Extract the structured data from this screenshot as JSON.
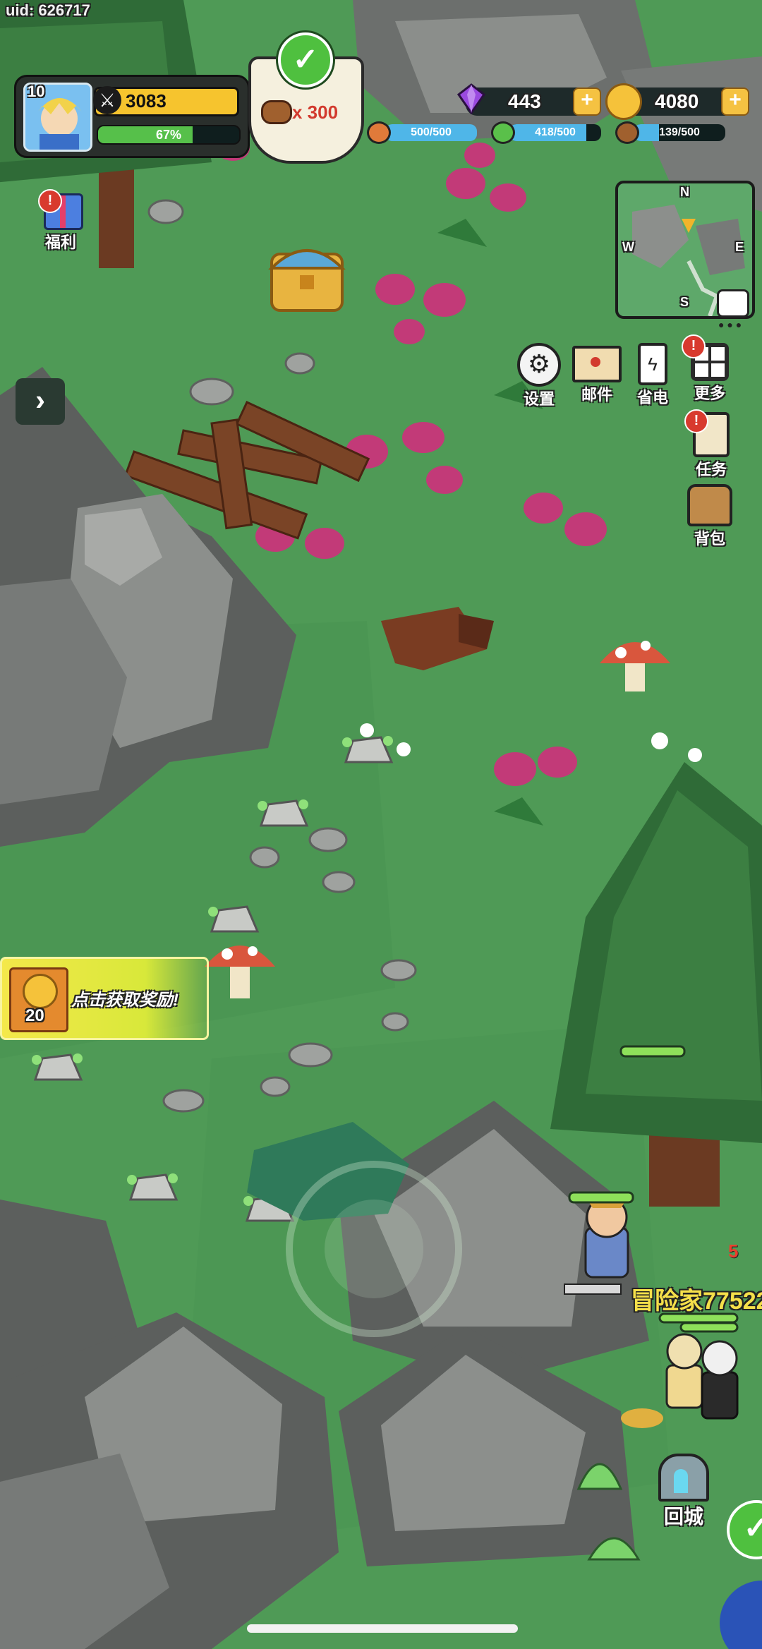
{
  "uid": "uid: 626717",
  "player": {
    "level": "10",
    "power": "3083",
    "exp_percent": "67%",
    "exp_value": 0.67
  },
  "quest_reward": {
    "amount": "x 300"
  },
  "currencies": {
    "gems": "443",
    "coins": "4080"
  },
  "resources": [
    {
      "name": "meat",
      "value": "500/500",
      "fill": 1.0,
      "color": "#4fb6e8"
    },
    {
      "name": "herb",
      "value": "418/500",
      "fill": 0.836,
      "color": "#4fb6e8"
    },
    {
      "name": "wood",
      "value": "139/500",
      "fill": 0.278,
      "color": "#4fb6e8"
    }
  ],
  "welfare": {
    "label": "福利"
  },
  "minimap": {
    "n": "N",
    "s": "S",
    "w": "W",
    "e": "E"
  },
  "menu": {
    "settings": "设置",
    "mail": "邮件",
    "power_save": "省电",
    "more": "更多",
    "tasks": "任务",
    "bag": "背包"
  },
  "reward_banner": {
    "count": "20",
    "text": "点击获取奖励!"
  },
  "hero": {
    "name": "冒险家77522",
    "damage": "5"
  },
  "return_city": {
    "label": "回城"
  }
}
